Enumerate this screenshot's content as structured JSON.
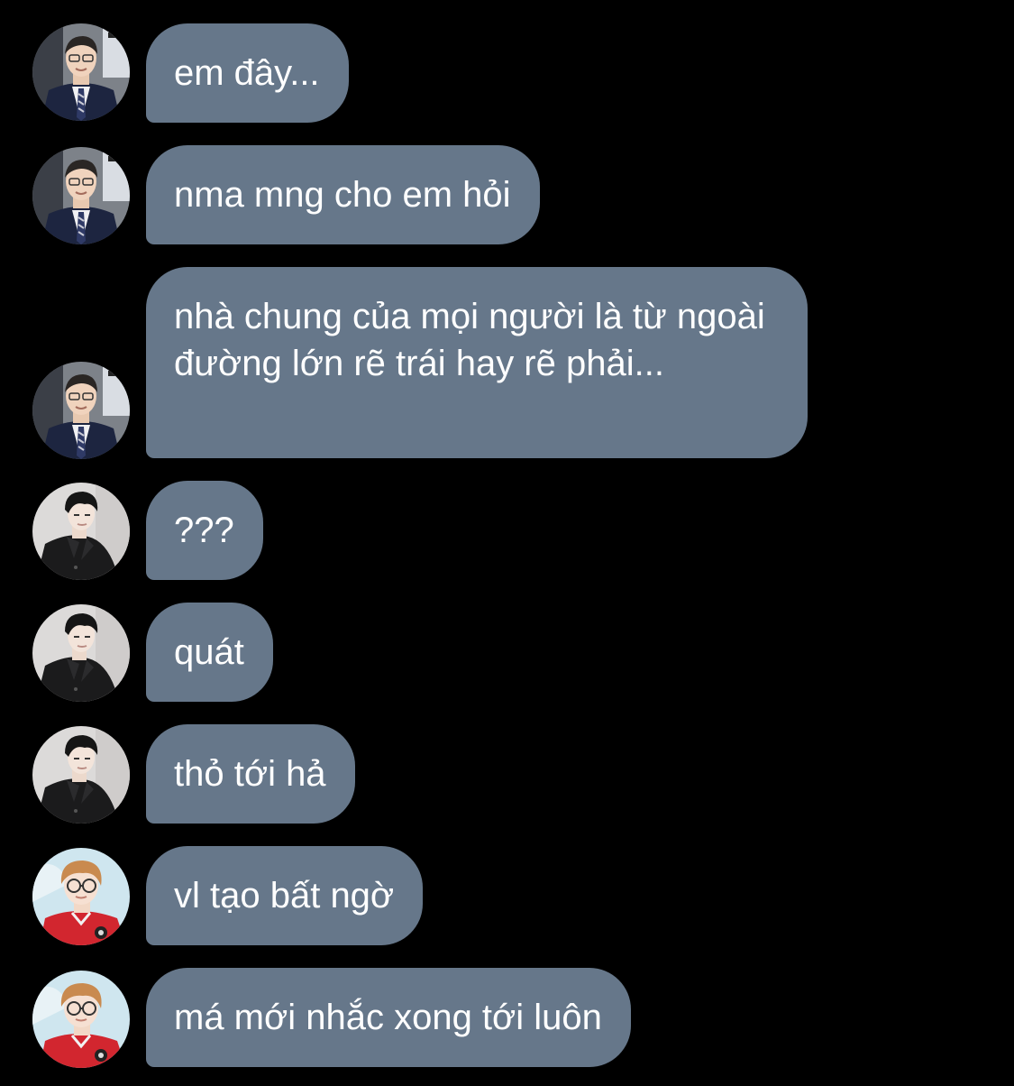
{
  "messages": [
    {
      "sender": "a",
      "text": "em đây..."
    },
    {
      "sender": "a",
      "text": "nma mng cho em hỏi"
    },
    {
      "sender": "a",
      "text": "nhà chung của mọi người là từ ngoài đường lớn rẽ trái hay rẽ phải..."
    },
    {
      "sender": "b",
      "text": "???"
    },
    {
      "sender": "b",
      "text": "quát"
    },
    {
      "sender": "b",
      "text": "thỏ tới hả"
    },
    {
      "sender": "c",
      "text": "vl tạo bất ngờ"
    },
    {
      "sender": "c",
      "text": "má mới nhắc xong tới luôn"
    }
  ],
  "colors": {
    "background": "#000000",
    "bubble": "#66778a",
    "text": "#ffffff"
  }
}
